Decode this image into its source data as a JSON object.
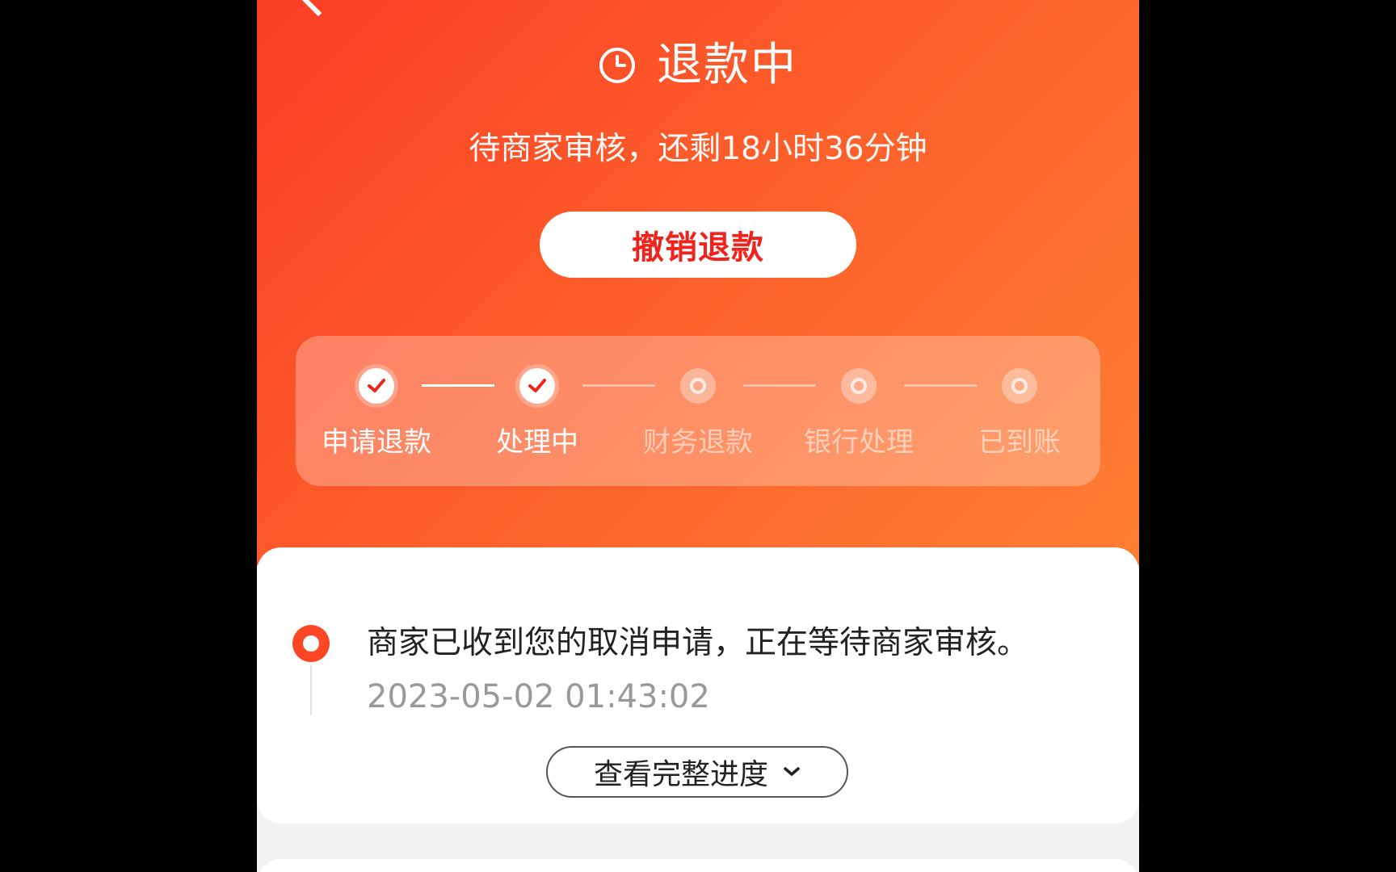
{
  "header": {
    "status_title": "退款中",
    "countdown_text": "待商家审核，还剩18小时36分钟",
    "cancel_button_label": "撤销退款"
  },
  "steps": [
    {
      "label": "申请退款",
      "state": "done"
    },
    {
      "label": "处理中",
      "state": "done"
    },
    {
      "label": "财务退款",
      "state": "pending"
    },
    {
      "label": "银行处理",
      "state": "pending"
    },
    {
      "label": "已到账",
      "state": "pending"
    }
  ],
  "progress": {
    "latest_event": "商家已收到您的取消申请，正在等待商家审核。",
    "latest_time": "2023-05-02 01:43:02",
    "view_full_label": "查看完整进度"
  },
  "colors": {
    "accent": "#fb3e25",
    "gradient_end": "#ff7f33",
    "cancel_text": "#f0221b",
    "muted_text": "#999999"
  },
  "icons": {
    "back": "back-arrow-icon",
    "status": "clock-icon",
    "step_done": "check-icon",
    "step_pending": "ring-dot-icon",
    "expand": "chevron-down-icon"
  }
}
